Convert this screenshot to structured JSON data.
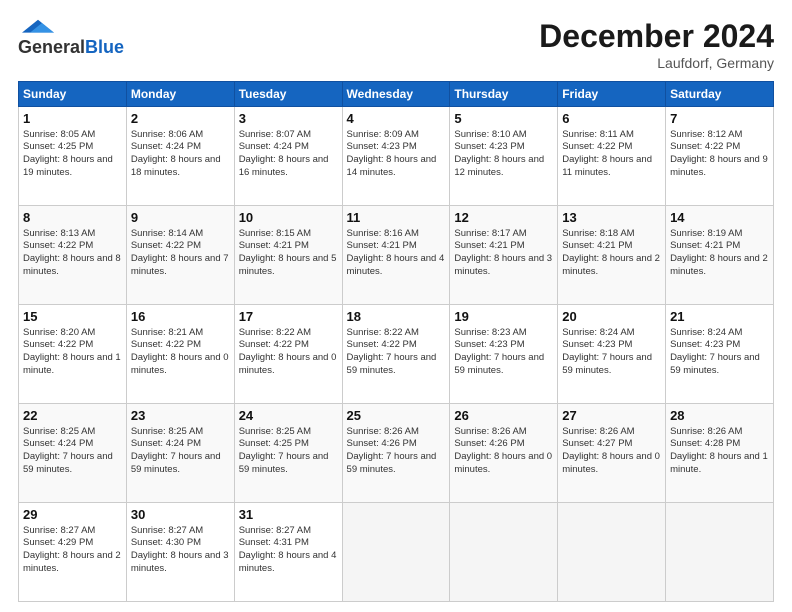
{
  "header": {
    "logo_general": "General",
    "logo_blue": "Blue",
    "month_title": "December 2024",
    "location": "Laufdorf, Germany"
  },
  "days_of_week": [
    "Sunday",
    "Monday",
    "Tuesday",
    "Wednesday",
    "Thursday",
    "Friday",
    "Saturday"
  ],
  "weeks": [
    [
      {
        "day": 1,
        "sr": "8:05 AM",
        "ss": "4:25 PM",
        "dl": "8 hours and 19 minutes."
      },
      {
        "day": 2,
        "sr": "8:06 AM",
        "ss": "4:24 PM",
        "dl": "8 hours and 18 minutes."
      },
      {
        "day": 3,
        "sr": "8:07 AM",
        "ss": "4:24 PM",
        "dl": "8 hours and 16 minutes."
      },
      {
        "day": 4,
        "sr": "8:09 AM",
        "ss": "4:23 PM",
        "dl": "8 hours and 14 minutes."
      },
      {
        "day": 5,
        "sr": "8:10 AM",
        "ss": "4:23 PM",
        "dl": "8 hours and 12 minutes."
      },
      {
        "day": 6,
        "sr": "8:11 AM",
        "ss": "4:22 PM",
        "dl": "8 hours and 11 minutes."
      },
      {
        "day": 7,
        "sr": "8:12 AM",
        "ss": "4:22 PM",
        "dl": "8 hours and 9 minutes."
      }
    ],
    [
      {
        "day": 8,
        "sr": "8:13 AM",
        "ss": "4:22 PM",
        "dl": "8 hours and 8 minutes."
      },
      {
        "day": 9,
        "sr": "8:14 AM",
        "ss": "4:22 PM",
        "dl": "8 hours and 7 minutes."
      },
      {
        "day": 10,
        "sr": "8:15 AM",
        "ss": "4:21 PM",
        "dl": "8 hours and 5 minutes."
      },
      {
        "day": 11,
        "sr": "8:16 AM",
        "ss": "4:21 PM",
        "dl": "8 hours and 4 minutes."
      },
      {
        "day": 12,
        "sr": "8:17 AM",
        "ss": "4:21 PM",
        "dl": "8 hours and 3 minutes."
      },
      {
        "day": 13,
        "sr": "8:18 AM",
        "ss": "4:21 PM",
        "dl": "8 hours and 2 minutes."
      },
      {
        "day": 14,
        "sr": "8:19 AM",
        "ss": "4:21 PM",
        "dl": "8 hours and 2 minutes."
      }
    ],
    [
      {
        "day": 15,
        "sr": "8:20 AM",
        "ss": "4:22 PM",
        "dl": "8 hours and 1 minute."
      },
      {
        "day": 16,
        "sr": "8:21 AM",
        "ss": "4:22 PM",
        "dl": "8 hours and 0 minutes."
      },
      {
        "day": 17,
        "sr": "8:22 AM",
        "ss": "4:22 PM",
        "dl": "8 hours and 0 minutes."
      },
      {
        "day": 18,
        "sr": "8:22 AM",
        "ss": "4:22 PM",
        "dl": "7 hours and 59 minutes."
      },
      {
        "day": 19,
        "sr": "8:23 AM",
        "ss": "4:23 PM",
        "dl": "7 hours and 59 minutes."
      },
      {
        "day": 20,
        "sr": "8:24 AM",
        "ss": "4:23 PM",
        "dl": "7 hours and 59 minutes."
      },
      {
        "day": 21,
        "sr": "8:24 AM",
        "ss": "4:23 PM",
        "dl": "7 hours and 59 minutes."
      }
    ],
    [
      {
        "day": 22,
        "sr": "8:25 AM",
        "ss": "4:24 PM",
        "dl": "7 hours and 59 minutes."
      },
      {
        "day": 23,
        "sr": "8:25 AM",
        "ss": "4:24 PM",
        "dl": "7 hours and 59 minutes."
      },
      {
        "day": 24,
        "sr": "8:25 AM",
        "ss": "4:25 PM",
        "dl": "7 hours and 59 minutes."
      },
      {
        "day": 25,
        "sr": "8:26 AM",
        "ss": "4:26 PM",
        "dl": "7 hours and 59 minutes."
      },
      {
        "day": 26,
        "sr": "8:26 AM",
        "ss": "4:26 PM",
        "dl": "8 hours and 0 minutes."
      },
      {
        "day": 27,
        "sr": "8:26 AM",
        "ss": "4:27 PM",
        "dl": "8 hours and 0 minutes."
      },
      {
        "day": 28,
        "sr": "8:26 AM",
        "ss": "4:28 PM",
        "dl": "8 hours and 1 minute."
      }
    ],
    [
      {
        "day": 29,
        "sr": "8:27 AM",
        "ss": "4:29 PM",
        "dl": "8 hours and 2 minutes."
      },
      {
        "day": 30,
        "sr": "8:27 AM",
        "ss": "4:30 PM",
        "dl": "8 hours and 3 minutes."
      },
      {
        "day": 31,
        "sr": "8:27 AM",
        "ss": "4:31 PM",
        "dl": "8 hours and 4 minutes."
      },
      null,
      null,
      null,
      null
    ]
  ]
}
